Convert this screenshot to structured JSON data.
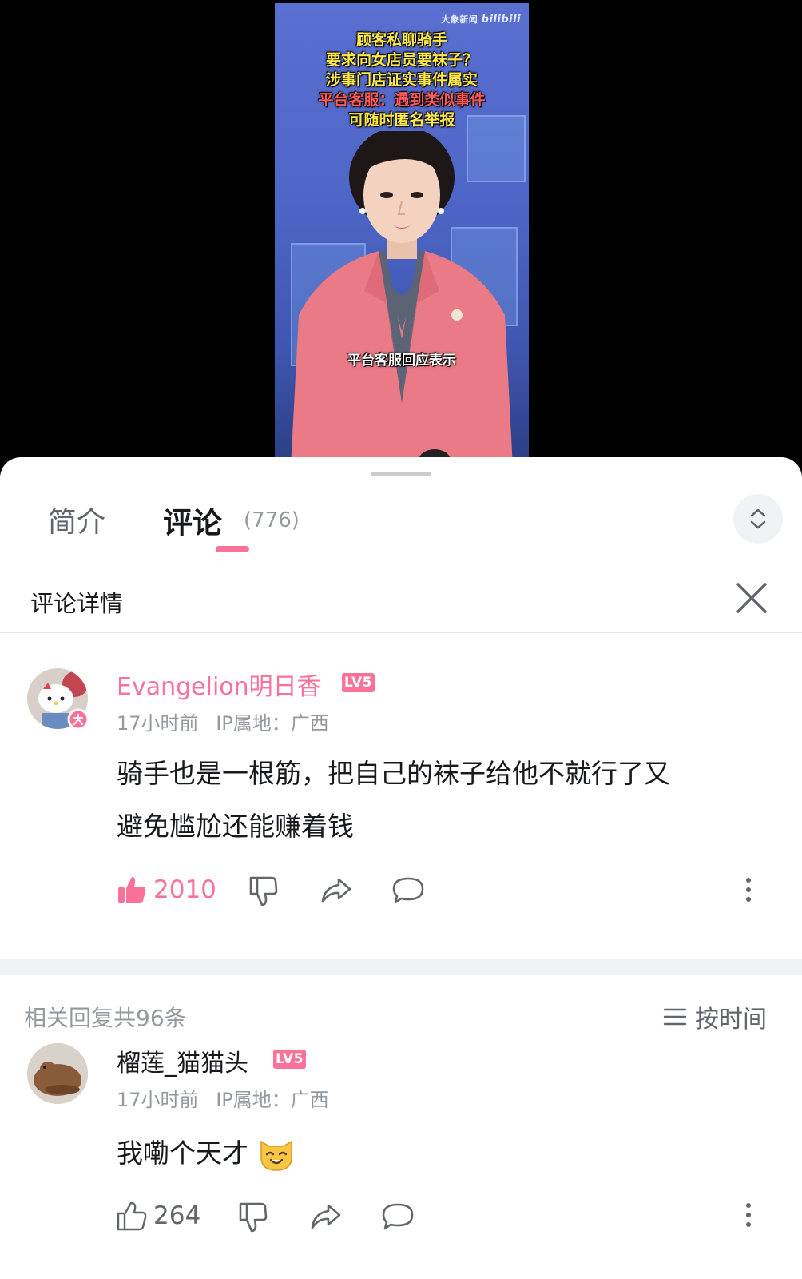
{
  "video": {
    "watermark_source": "大象新闻",
    "watermark_brand": "bilibili",
    "headline_lines": [
      "顾客私聊骑手",
      "要求向女店员要袜子？",
      "涉事门店证实事件属实",
      "平台客服：遇到类似事件",
      "可随时匿名举报"
    ],
    "subtitle": "平台客服回应表示"
  },
  "tabs": {
    "intro_label": "简介",
    "comments_label": "评论",
    "comments_count": "(776)"
  },
  "detail": {
    "title": "评论详情"
  },
  "main_comment": {
    "username": "Evangelion明日香",
    "level": "LV5",
    "time": "17小时前",
    "ip": "IP属地：广西",
    "text_line1": "骑手也是一根筋，把自己的袜子给他不就行了又",
    "text_line2": "避免尴尬还能赚着钱",
    "likes": "2010",
    "username_color": "#fb7299",
    "liked": true
  },
  "replies": {
    "header": "相关回复共96条",
    "sort_label": "按时间"
  },
  "reply_comment": {
    "username": "榴莲_猫猫头",
    "level": "LV5",
    "time": "17小时前",
    "ip": "IP属地：广西",
    "text": "我嘞个天才",
    "likes": "264",
    "liked": false
  },
  "colors": {
    "accent_pink": "#fb7299",
    "level_badge": "#fb7299",
    "secondary_text": "#9499a0",
    "icon_gray": "#61666d"
  },
  "icons": [
    "chevron-updown-icon",
    "close-icon",
    "thumbs-up-icon",
    "thumbs-down-icon",
    "share-icon",
    "reply-icon",
    "more-icon",
    "sort-icon",
    "emoji-cat-icon"
  ]
}
